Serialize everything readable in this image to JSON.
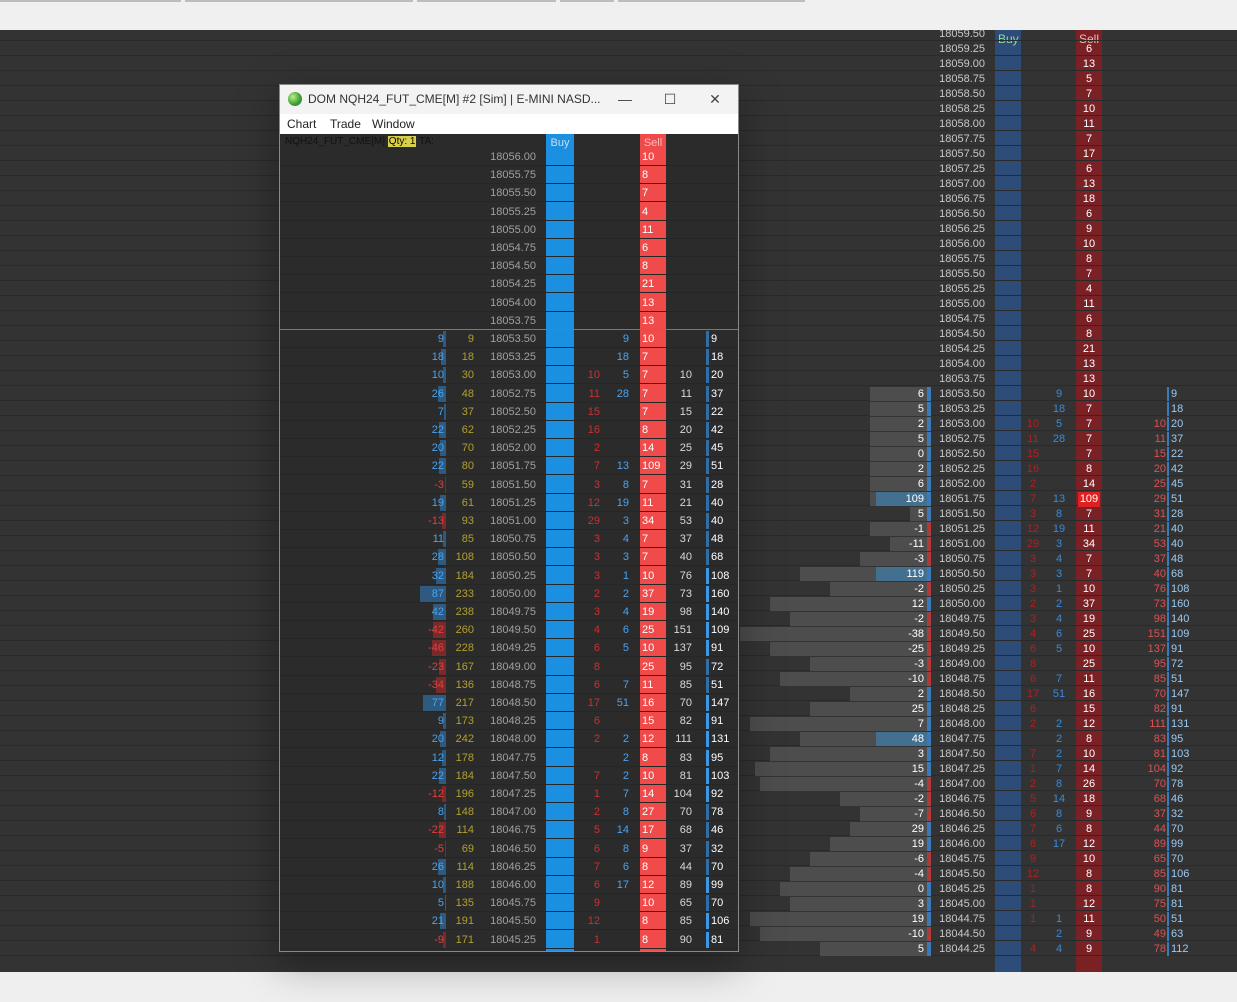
{
  "headers": {
    "buy": "Buy",
    "sell": "Sell"
  },
  "window": {
    "title": "DOM NQH24_FUT_CME[M] #2 [Sim]  | E-MINI NASD...",
    "controls": {
      "minimize": "—",
      "maximize": "☐",
      "close": "✕"
    },
    "menus": [
      "Chart",
      "Trade",
      "Window"
    ],
    "instrument": "NQH24_FUT_CME[M]",
    "qty": "Qty: 1",
    "ta": "TA:"
  },
  "colors": {
    "buy": "#1b8fe0",
    "sell": "#f04a4a",
    "positive": "#4aa3f0",
    "negative": "#e04040",
    "cumulative": "#b0a030",
    "price": "#a0a0a0"
  },
  "ask_levels": [
    {
      "price": "18056.00",
      "ask": "10"
    },
    {
      "price": "18055.75",
      "ask": "8"
    },
    {
      "price": "18055.50",
      "ask": "7"
    },
    {
      "price": "18055.25",
      "ask": "4"
    },
    {
      "price": "18055.00",
      "ask": "11"
    },
    {
      "price": "18054.75",
      "ask": "6"
    },
    {
      "price": "18054.50",
      "ask": "8"
    },
    {
      "price": "18054.25",
      "ask": "21"
    },
    {
      "price": "18054.00",
      "ask": "13"
    },
    {
      "price": "18053.75",
      "ask": "13"
    }
  ],
  "traded_levels": [
    {
      "delta": "9",
      "cum": "9",
      "price": "18053.50",
      "sellvol": "",
      "buyvol": "9",
      "ask": "10",
      "total_sell": "",
      "total_buy": "9"
    },
    {
      "delta": "18",
      "cum": "18",
      "price": "18053.25",
      "sellvol": "",
      "buyvol": "18",
      "ask": "7",
      "total_sell": "",
      "total_buy": "18"
    },
    {
      "delta": "10",
      "cum": "30",
      "price": "18053.00",
      "sellvol": "10",
      "buyvol": "5",
      "ask": "7",
      "total_sell": "10",
      "total_buy": "20"
    },
    {
      "delta": "26",
      "cum": "48",
      "price": "18052.75",
      "sellvol": "11",
      "buyvol": "28",
      "ask": "7",
      "total_sell": "11",
      "total_buy": "37"
    },
    {
      "delta": "7",
      "cum": "37",
      "price": "18052.50",
      "sellvol": "15",
      "buyvol": "",
      "ask": "7",
      "total_sell": "15",
      "total_buy": "22"
    },
    {
      "delta": "22",
      "cum": "62",
      "price": "18052.25",
      "sellvol": "16",
      "buyvol": "",
      "ask": "8",
      "total_sell": "20",
      "total_buy": "42"
    },
    {
      "delta": "20",
      "cum": "70",
      "price": "18052.00",
      "sellvol": "2",
      "buyvol": "",
      "ask": "14",
      "total_sell": "25",
      "total_buy": "45"
    },
    {
      "delta": "22",
      "cum": "80",
      "price": "18051.75",
      "sellvol": "7",
      "buyvol": "13",
      "ask": "109",
      "total_sell": "29",
      "total_buy": "51"
    },
    {
      "delta": "-3",
      "cum": "59",
      "price": "18051.50",
      "sellvol": "3",
      "buyvol": "8",
      "ask": "7",
      "total_sell": "31",
      "total_buy": "28"
    },
    {
      "delta": "19",
      "cum": "61",
      "price": "18051.25",
      "sellvol": "12",
      "buyvol": "19",
      "ask": "11",
      "total_sell": "21",
      "total_buy": "40"
    },
    {
      "delta": "-13",
      "cum": "93",
      "price": "18051.00",
      "sellvol": "29",
      "buyvol": "3",
      "ask": "34",
      "total_sell": "53",
      "total_buy": "40"
    },
    {
      "delta": "11",
      "cum": "85",
      "price": "18050.75",
      "sellvol": "3",
      "buyvol": "4",
      "ask": "7",
      "total_sell": "37",
      "total_buy": "48"
    },
    {
      "delta": "28",
      "cum": "108",
      "price": "18050.50",
      "sellvol": "3",
      "buyvol": "3",
      "ask": "7",
      "total_sell": "40",
      "total_buy": "68"
    },
    {
      "delta": "32",
      "cum": "184",
      "price": "18050.25",
      "sellvol": "3",
      "buyvol": "1",
      "ask": "10",
      "total_sell": "76",
      "total_buy": "108"
    },
    {
      "delta": "87",
      "cum": "233",
      "price": "18050.00",
      "sellvol": "2",
      "buyvol": "2",
      "ask": "37",
      "total_sell": "73",
      "total_buy": "160"
    },
    {
      "delta": "42",
      "cum": "238",
      "price": "18049.75",
      "sellvol": "3",
      "buyvol": "4",
      "ask": "19",
      "total_sell": "98",
      "total_buy": "140"
    },
    {
      "delta": "-42",
      "cum": "260",
      "price": "18049.50",
      "sellvol": "4",
      "buyvol": "6",
      "ask": "25",
      "total_sell": "151",
      "total_buy": "109"
    },
    {
      "delta": "-46",
      "cum": "228",
      "price": "18049.25",
      "sellvol": "6",
      "buyvol": "5",
      "ask": "10",
      "total_sell": "137",
      "total_buy": "91"
    },
    {
      "delta": "-23",
      "cum": "167",
      "price": "18049.00",
      "sellvol": "8",
      "buyvol": "",
      "ask": "25",
      "total_sell": "95",
      "total_buy": "72"
    },
    {
      "delta": "-34",
      "cum": "136",
      "price": "18048.75",
      "sellvol": "6",
      "buyvol": "7",
      "ask": "11",
      "total_sell": "85",
      "total_buy": "51"
    },
    {
      "delta": "77",
      "cum": "217",
      "price": "18048.50",
      "sellvol": "17",
      "buyvol": "51",
      "ask": "16",
      "total_sell": "70",
      "total_buy": "147"
    },
    {
      "delta": "9",
      "cum": "173",
      "price": "18048.25",
      "sellvol": "6",
      "buyvol": "",
      "ask": "15",
      "total_sell": "82",
      "total_buy": "91"
    },
    {
      "delta": "20",
      "cum": "242",
      "price": "18048.00",
      "sellvol": "2",
      "buyvol": "2",
      "ask": "12",
      "total_sell": "111",
      "total_buy": "131"
    },
    {
      "delta": "12",
      "cum": "178",
      "price": "18047.75",
      "sellvol": "",
      "buyvol": "2",
      "ask": "8",
      "total_sell": "83",
      "total_buy": "95"
    },
    {
      "delta": "22",
      "cum": "184",
      "price": "18047.50",
      "sellvol": "7",
      "buyvol": "2",
      "ask": "10",
      "total_sell": "81",
      "total_buy": "103"
    },
    {
      "delta": "-12",
      "cum": "196",
      "price": "18047.25",
      "sellvol": "1",
      "buyvol": "7",
      "ask": "14",
      "total_sell": "104",
      "total_buy": "92"
    },
    {
      "delta": "8",
      "cum": "148",
      "price": "18047.00",
      "sellvol": "2",
      "buyvol": "8",
      "ask": "27",
      "total_sell": "70",
      "total_buy": "78"
    },
    {
      "delta": "-22",
      "cum": "114",
      "price": "18046.75",
      "sellvol": "5",
      "buyvol": "14",
      "ask": "17",
      "total_sell": "68",
      "total_buy": "46"
    },
    {
      "delta": "-5",
      "cum": "69",
      "price": "18046.50",
      "sellvol": "6",
      "buyvol": "8",
      "ask": "9",
      "total_sell": "37",
      "total_buy": "32"
    },
    {
      "delta": "26",
      "cum": "114",
      "price": "18046.25",
      "sellvol": "7",
      "buyvol": "6",
      "ask": "8",
      "total_sell": "44",
      "total_buy": "70"
    },
    {
      "delta": "10",
      "cum": "188",
      "price": "18046.00",
      "sellvol": "6",
      "buyvol": "17",
      "ask": "12",
      "total_sell": "89",
      "total_buy": "99"
    },
    {
      "delta": "5",
      "cum": "135",
      "price": "18045.75",
      "sellvol": "9",
      "buyvol": "",
      "ask": "10",
      "total_sell": "65",
      "total_buy": "70"
    },
    {
      "delta": "21",
      "cum": "191",
      "price": "18045.50",
      "sellvol": "12",
      "buyvol": "",
      "ask": "8",
      "total_sell": "85",
      "total_buy": "106"
    },
    {
      "delta": "-9",
      "cum": "171",
      "price": "18045.25",
      "sellvol": "1",
      "buyvol": "",
      "ask": "8",
      "total_sell": "90",
      "total_buy": "81"
    }
  ],
  "background_dom": {
    "top_partial_price": "18059.50",
    "ask_levels": [
      {
        "price": "18059.25",
        "ask": "6"
      },
      {
        "price": "18059.00",
        "ask": "13"
      },
      {
        "price": "18058.75",
        "ask": "5"
      },
      {
        "price": "18058.50",
        "ask": "7"
      },
      {
        "price": "18058.25",
        "ask": "10"
      },
      {
        "price": "18058.00",
        "ask": "11"
      },
      {
        "price": "18057.75",
        "ask": "7"
      },
      {
        "price": "18057.50",
        "ask": "17"
      },
      {
        "price": "18057.25",
        "ask": "6"
      },
      {
        "price": "18057.00",
        "ask": "13"
      },
      {
        "price": "18056.75",
        "ask": "18"
      },
      {
        "price": "18056.50",
        "ask": "6"
      },
      {
        "price": "18056.25",
        "ask": "9"
      },
      {
        "price": "18056.00",
        "ask": "10"
      },
      {
        "price": "18055.75",
        "ask": "8"
      },
      {
        "price": "18055.50",
        "ask": "7"
      },
      {
        "price": "18055.25",
        "ask": "4"
      },
      {
        "price": "18055.00",
        "ask": "11"
      },
      {
        "price": "18054.75",
        "ask": "6"
      },
      {
        "price": "18054.50",
        "ask": "8"
      },
      {
        "price": "18054.25",
        "ask": "21"
      },
      {
        "price": "18054.00",
        "ask": "13"
      },
      {
        "price": "18053.75",
        "ask": "13"
      }
    ],
    "traded_levels": [
      {
        "delta": "6",
        "price": "18053.50",
        "sellvol": "",
        "buyvol": "9",
        "ask": "10",
        "total_sell": "",
        "total_buy": "9"
      },
      {
        "delta": "5",
        "price": "18053.25",
        "sellvol": "",
        "buyvol": "18",
        "ask": "7",
        "total_sell": "",
        "total_buy": "18"
      },
      {
        "delta": "2",
        "price": "18053.00",
        "sellvol": "10",
        "buyvol": "5",
        "ask": "7",
        "total_sell": "10",
        "total_buy": "20"
      },
      {
        "delta": "5",
        "price": "18052.75",
        "sellvol": "11",
        "buyvol": "28",
        "ask": "7",
        "total_sell": "11",
        "total_buy": "37"
      },
      {
        "delta": "0",
        "price": "18052.50",
        "sellvol": "15",
        "buyvol": "",
        "ask": "7",
        "total_sell": "15",
        "total_buy": "22"
      },
      {
        "delta": "2",
        "price": "18052.25",
        "sellvol": "16",
        "buyvol": "",
        "ask": "8",
        "total_sell": "20",
        "total_buy": "42"
      },
      {
        "delta": "6",
        "price": "18052.00",
        "sellvol": "2",
        "buyvol": "",
        "ask": "14",
        "total_sell": "25",
        "total_buy": "45"
      },
      {
        "delta": "109",
        "price": "18051.75",
        "sellvol": "7",
        "buyvol": "13",
        "ask": "109",
        "total_sell": "29",
        "total_buy": "51"
      },
      {
        "delta": "5",
        "price": "18051.50",
        "sellvol": "3",
        "buyvol": "8",
        "ask": "7",
        "total_sell": "31",
        "total_buy": "28"
      },
      {
        "delta": "-1",
        "price": "18051.25",
        "sellvol": "12",
        "buyvol": "19",
        "ask": "11",
        "total_sell": "21",
        "total_buy": "40"
      },
      {
        "delta": "-11",
        "price": "18051.00",
        "sellvol": "29",
        "buyvol": "3",
        "ask": "34",
        "total_sell": "53",
        "total_buy": "40"
      },
      {
        "delta": "-3",
        "price": "18050.75",
        "sellvol": "3",
        "buyvol": "4",
        "ask": "7",
        "total_sell": "37",
        "total_buy": "48"
      },
      {
        "delta": "119",
        "price": "18050.50",
        "sellvol": "3",
        "buyvol": "3",
        "ask": "7",
        "total_sell": "40",
        "total_buy": "68"
      },
      {
        "delta": "-2",
        "price": "18050.25",
        "sellvol": "3",
        "buyvol": "1",
        "ask": "10",
        "total_sell": "76",
        "total_buy": "108"
      },
      {
        "delta": "12",
        "price": "18050.00",
        "sellvol": "2",
        "buyvol": "2",
        "ask": "37",
        "total_sell": "73",
        "total_buy": "160"
      },
      {
        "delta": "-2",
        "price": "18049.75",
        "sellvol": "3",
        "buyvol": "4",
        "ask": "19",
        "total_sell": "98",
        "total_buy": "140"
      },
      {
        "delta": "-38",
        "price": "18049.50",
        "sellvol": "4",
        "buyvol": "6",
        "ask": "25",
        "total_sell": "151",
        "total_buy": "109"
      },
      {
        "delta": "-25",
        "price": "18049.25",
        "sellvol": "6",
        "buyvol": "5",
        "ask": "10",
        "total_sell": "137",
        "total_buy": "91"
      },
      {
        "delta": "-3",
        "price": "18049.00",
        "sellvol": "8",
        "buyvol": "",
        "ask": "25",
        "total_sell": "95",
        "total_buy": "72"
      },
      {
        "delta": "-10",
        "price": "18048.75",
        "sellvol": "6",
        "buyvol": "7",
        "ask": "11",
        "total_sell": "85",
        "total_buy": "51"
      },
      {
        "delta": "2",
        "price": "18048.50",
        "sellvol": "17",
        "buyvol": "51",
        "ask": "16",
        "total_sell": "70",
        "total_buy": "147"
      },
      {
        "delta": "25",
        "price": "18048.25",
        "sellvol": "6",
        "buyvol": "",
        "ask": "15",
        "total_sell": "82",
        "total_buy": "91"
      },
      {
        "delta": "7",
        "price": "18048.00",
        "sellvol": "2",
        "buyvol": "2",
        "ask": "12",
        "total_sell": "111",
        "total_buy": "131"
      },
      {
        "delta": "48",
        "price": "18047.75",
        "sellvol": "",
        "buyvol": "2",
        "ask": "8",
        "total_sell": "83",
        "total_buy": "95"
      },
      {
        "delta": "3",
        "price": "18047.50",
        "sellvol": "7",
        "buyvol": "2",
        "ask": "10",
        "total_sell": "81",
        "total_buy": "103"
      },
      {
        "delta": "15",
        "price": "18047.25",
        "sellvol": "1",
        "buyvol": "7",
        "ask": "14",
        "total_sell": "104",
        "total_buy": "92"
      },
      {
        "delta": "-4",
        "price": "18047.00",
        "sellvol": "2",
        "buyvol": "8",
        "ask": "26",
        "total_sell": "70",
        "total_buy": "78"
      },
      {
        "delta": "-2",
        "price": "18046.75",
        "sellvol": "5",
        "buyvol": "14",
        "ask": "18",
        "total_sell": "68",
        "total_buy": "46"
      },
      {
        "delta": "-7",
        "price": "18046.50",
        "sellvol": "6",
        "buyvol": "8",
        "ask": "9",
        "total_sell": "37",
        "total_buy": "32"
      },
      {
        "delta": "29",
        "price": "18046.25",
        "sellvol": "7",
        "buyvol": "6",
        "ask": "8",
        "total_sell": "44",
        "total_buy": "70"
      },
      {
        "delta": "19",
        "price": "18046.00",
        "sellvol": "6",
        "buyvol": "17",
        "ask": "12",
        "total_sell": "89",
        "total_buy": "99"
      },
      {
        "delta": "-6",
        "price": "18045.75",
        "sellvol": "9",
        "buyvol": "",
        "ask": "10",
        "total_sell": "65",
        "total_buy": "70"
      },
      {
        "delta": "-4",
        "price": "18045.50",
        "sellvol": "12",
        "buyvol": "",
        "ask": "8",
        "total_sell": "85",
        "total_buy": "106"
      },
      {
        "delta": "0",
        "price": "18045.25",
        "sellvol": "1",
        "buyvol": "",
        "ask": "8",
        "total_sell": "90",
        "total_buy": "81"
      },
      {
        "delta": "3",
        "price": "18045.00",
        "sellvol": "1",
        "buyvol": "",
        "ask": "12",
        "total_sell": "75",
        "total_buy": "81"
      },
      {
        "delta": "19",
        "price": "18044.75",
        "sellvol": "1",
        "buyvol": "1",
        "ask": "11",
        "total_sell": "50",
        "total_buy": "51"
      },
      {
        "delta": "-10",
        "price": "18044.50",
        "sellvol": "",
        "buyvol": "2",
        "ask": "9",
        "total_sell": "49",
        "total_buy": "63"
      },
      {
        "delta": "5",
        "price": "18044.25",
        "sellvol": "4",
        "buyvol": "4",
        "ask": "9",
        "total_sell": "78",
        "total_buy": "112"
      }
    ]
  }
}
